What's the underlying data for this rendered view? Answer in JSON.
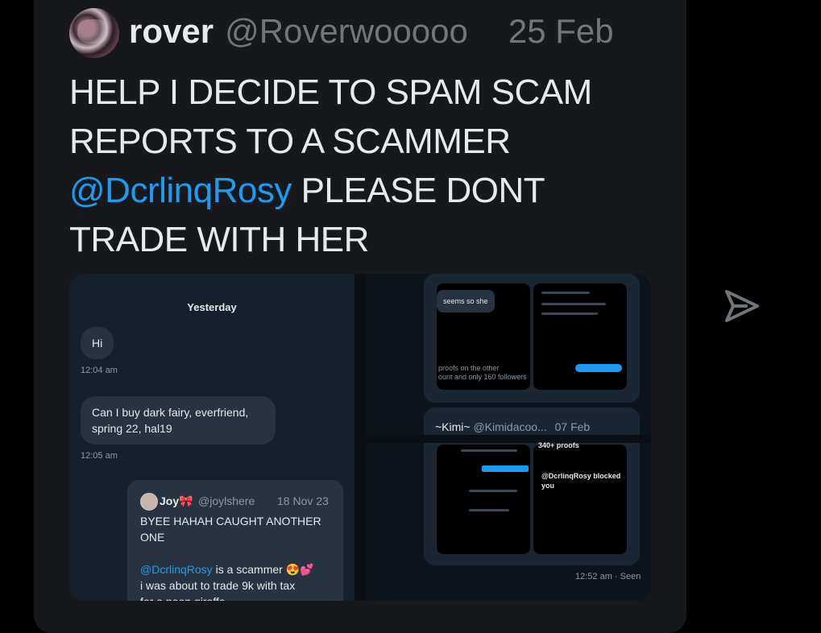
{
  "tweet": {
    "author_name": "rover",
    "author_handle": "@Roverwooooo",
    "date": "25 Feb",
    "text_line1": "HELP I DECIDE TO SPAM SCAM",
    "text_line2": "REPORTS TO A SCAMMER",
    "mention": "@DcrlinqRosy",
    "text_line3_rest": " PLEASE DONT",
    "text_line4": "TRADE WITH HER"
  },
  "media": {
    "left": {
      "day_label": "Yesterday",
      "msg1": "Hi",
      "time1": "12:04 am",
      "msg2_line1": "Can I buy dark fairy, everfriend,",
      "msg2_line2": "spring 22, hal19",
      "time2": "12:05 am",
      "quote": {
        "name": "Joy🎀",
        "handle": "@joylshere",
        "date": "18 Nov 23",
        "line1": "BYEE HAHAH CAUGHT ANOTHER",
        "line2": "ONE",
        "mention": "@DcrlinqRosy",
        "after_mention": " is a scammer 😍💕",
        "line4": "i was about to trade 9k with tax",
        "line5": "for a neon giraffe"
      }
    },
    "right": {
      "kimi_name": "~Kimi~",
      "kimi_handle": "@Kimidacoo...",
      "kimi_date": "07 Feb",
      "seem_so": "seems so she",
      "proofs": "proofs on the other",
      "followers": "ount and only 160 followers",
      "blocked_title": "@DcrlinqRosy blocked",
      "blocked_you": "you",
      "proofs_count": "340+ proofs",
      "seen": "12:52 am · Seen"
    }
  },
  "icons": {
    "share": "share-arrow-icon"
  },
  "colors": {
    "background": "#000000",
    "card": "#16181c",
    "accent": "#1d9bf0",
    "text": "#e7e9ea",
    "muted": "#71767b"
  }
}
